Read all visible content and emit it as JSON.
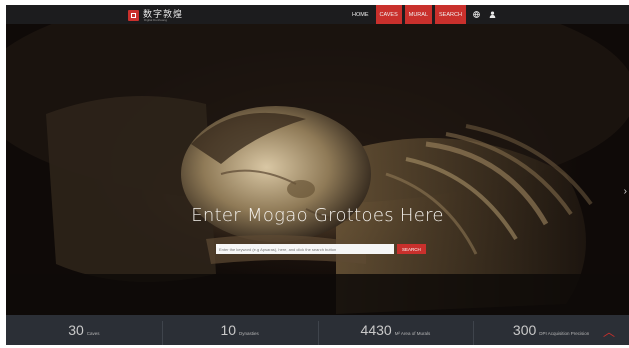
{
  "header": {
    "logo_text": "数字敦煌",
    "logo_sub": "Digital Dunhuang",
    "nav": [
      {
        "label": "HOME",
        "active": false
      },
      {
        "label": "CAVES",
        "active": true
      },
      {
        "label": "MURAL",
        "active": true
      },
      {
        "label": "SEARCH",
        "active": true
      }
    ],
    "icons": [
      "globe-icon",
      "user-icon"
    ]
  },
  "hero": {
    "title": "Enter Mogao Grottoes Here",
    "search_placeholder": "Enter the keyword (e.g Apsaras), here, and click the search button",
    "search_button": "SEARCH"
  },
  "stats": [
    {
      "value": "30",
      "unit": "Caves"
    },
    {
      "value": "10",
      "unit": "Dynasties"
    },
    {
      "value": "4430",
      "unit": "M² Area of Murals"
    },
    {
      "value": "300",
      "unit": "DPI Acquisition Precision"
    }
  ],
  "colors": {
    "accent": "#c9302c",
    "topbar": "#1c1c1e",
    "statsbar": "#2b2f36"
  }
}
